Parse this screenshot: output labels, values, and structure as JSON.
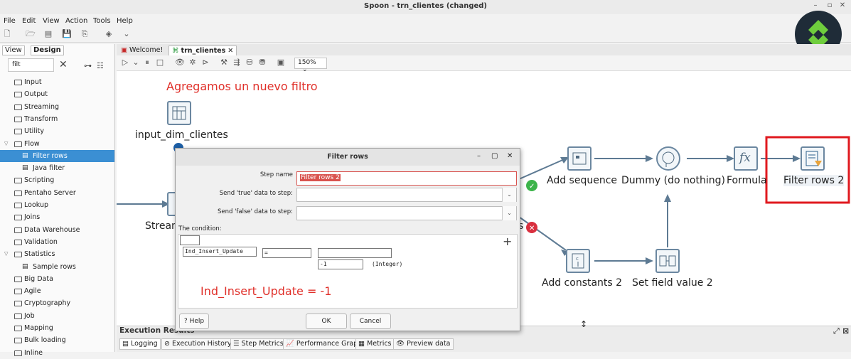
{
  "window": {
    "title": "Spoon - trn_clientes (changed)"
  },
  "menu": [
    "File",
    "Edit",
    "View",
    "Action",
    "Tools",
    "Help"
  ],
  "left_panel": {
    "tabs": [
      "View",
      "Design"
    ],
    "search_value": "filt",
    "tree": [
      {
        "label": "Input"
      },
      {
        "label": "Output"
      },
      {
        "label": "Streaming"
      },
      {
        "label": "Transform"
      },
      {
        "label": "Utility"
      },
      {
        "label": "Flow"
      },
      {
        "label": "Filter rows"
      },
      {
        "label": "Java filter"
      },
      {
        "label": "Scripting"
      },
      {
        "label": "Pentaho Server"
      },
      {
        "label": "Lookup"
      },
      {
        "label": "Joins"
      },
      {
        "label": "Data Warehouse"
      },
      {
        "label": "Validation"
      },
      {
        "label": "Statistics"
      },
      {
        "label": "Sample rows"
      },
      {
        "label": "Big Data"
      },
      {
        "label": "Agile"
      },
      {
        "label": "Cryptography"
      },
      {
        "label": "Job"
      },
      {
        "label": "Mapping"
      },
      {
        "label": "Bulk loading"
      },
      {
        "label": "Inline"
      }
    ]
  },
  "editor": {
    "tabs": [
      "Welcome!",
      "trn_clientes"
    ],
    "zoom": "150%"
  },
  "canvas": {
    "annotation": "Agregamos un nuevo filtro",
    "condition_note": "Ind_Insert_Update = -1",
    "steps": {
      "input": "input_dim_clientes",
      "stream": "Stream",
      "add_sequence": "Add sequence",
      "dummy": "Dummy (do nothing)",
      "formula": "Formula",
      "filter2": "Filter rows 2",
      "add_constants": "Add constants 2",
      "set_field": "Set field value 2",
      "partial": "s"
    }
  },
  "dialog": {
    "title": "Filter rows",
    "step_name_label": "Step name",
    "step_name_value": "Filter rows 2",
    "true_label": "Send 'true' data to step:",
    "false_label": "Send 'false' data to step:",
    "condition_label": "The condition:",
    "cond_field": "Ind_Insert_Update",
    "cond_op": "=",
    "cond_value": "-1",
    "cond_type": "(Integer)",
    "help": "Help",
    "ok": "OK",
    "cancel": "Cancel"
  },
  "execution": {
    "title": "Execution Results",
    "tabs": [
      "Logging",
      "Execution History",
      "Step Metrics",
      "Performance Graph",
      "Metrics",
      "Preview data"
    ]
  }
}
